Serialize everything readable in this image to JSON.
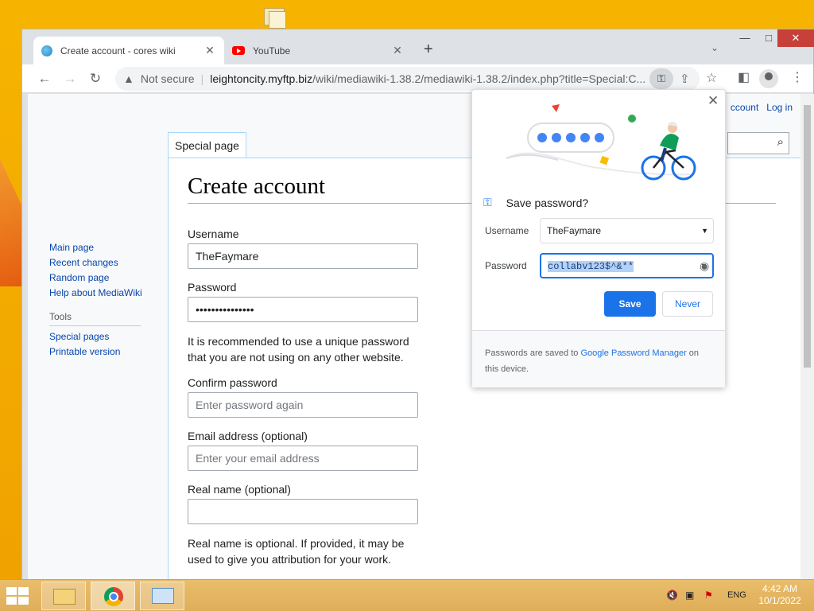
{
  "window": {
    "tabs": [
      {
        "title": "Create account - cores wiki",
        "close": "✕",
        "active": true
      },
      {
        "title": "YouTube",
        "close": "✕",
        "active": false
      }
    ],
    "new_tab": "+",
    "controls": {
      "minimize": "—",
      "maximize": "□",
      "close": "✕"
    }
  },
  "toolbar": {
    "security_text": "Not secure",
    "url_host": "leightoncity.myftp.biz",
    "url_path": "/wiki/mediawiki-1.38.2/mediawiki-1.38.2/index.php?title=Special:C..."
  },
  "wiki": {
    "special_tab": "Special page",
    "top_links": [
      "ccount",
      "Log in"
    ],
    "heading": "Create account",
    "nav": {
      "main": [
        "Main page",
        "Recent changes",
        "Random page",
        "Help about MediaWiki"
      ],
      "tools_header": "Tools",
      "tools": [
        "Special pages",
        "Printable version"
      ]
    },
    "form": {
      "username_label": "Username",
      "username_value": "TheFaymare",
      "password_label": "Password",
      "password_value": "•••••••••••••••",
      "password_help": "It is recommended to use a unique password that you are not using on any other website.",
      "confirm_label": "Confirm password",
      "confirm_placeholder": "Enter password again",
      "email_label": "Email address (optional)",
      "email_placeholder": "Enter your email address",
      "realname_label": "Real name (optional)",
      "realname_value": "",
      "realname_help": "Real name is optional. If provided, it may be used to give you attribution for your work."
    }
  },
  "popup": {
    "title": "Save password?",
    "username_label": "Username",
    "username_value": "TheFaymare",
    "password_label": "Password",
    "password_value": "collabv123$^&**",
    "save_label": "Save",
    "never_label": "Never",
    "footer_prefix": "Passwords are saved to ",
    "footer_link": "Google Password Manager",
    "footer_suffix": " on this device.",
    "accent": "#1a73e8"
  },
  "taskbar": {
    "language": "ENG",
    "time": "4:42 AM",
    "date": "10/1/2022"
  }
}
